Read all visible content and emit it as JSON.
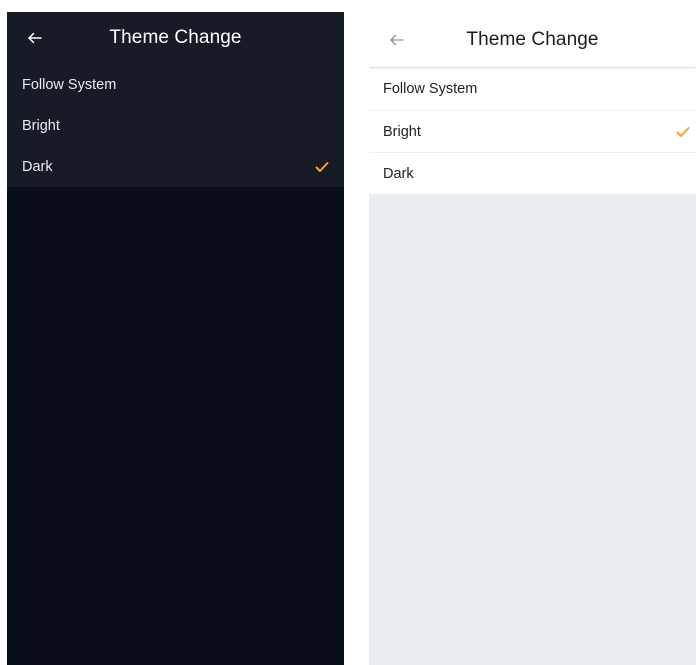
{
  "accent_color": "#f5a623",
  "screens": [
    {
      "theme": "dark",
      "title": "Theme Change",
      "back_icon": "arrow-left-icon",
      "options": [
        {
          "label": "Follow System",
          "selected": false
        },
        {
          "label": "Bright",
          "selected": false
        },
        {
          "label": "Dark",
          "selected": true
        }
      ]
    },
    {
      "theme": "light",
      "title": "Theme Change",
      "back_icon": "arrow-left-icon",
      "options": [
        {
          "label": "Follow System",
          "selected": false
        },
        {
          "label": "Bright",
          "selected": true
        },
        {
          "label": "Dark",
          "selected": false
        }
      ]
    }
  ]
}
